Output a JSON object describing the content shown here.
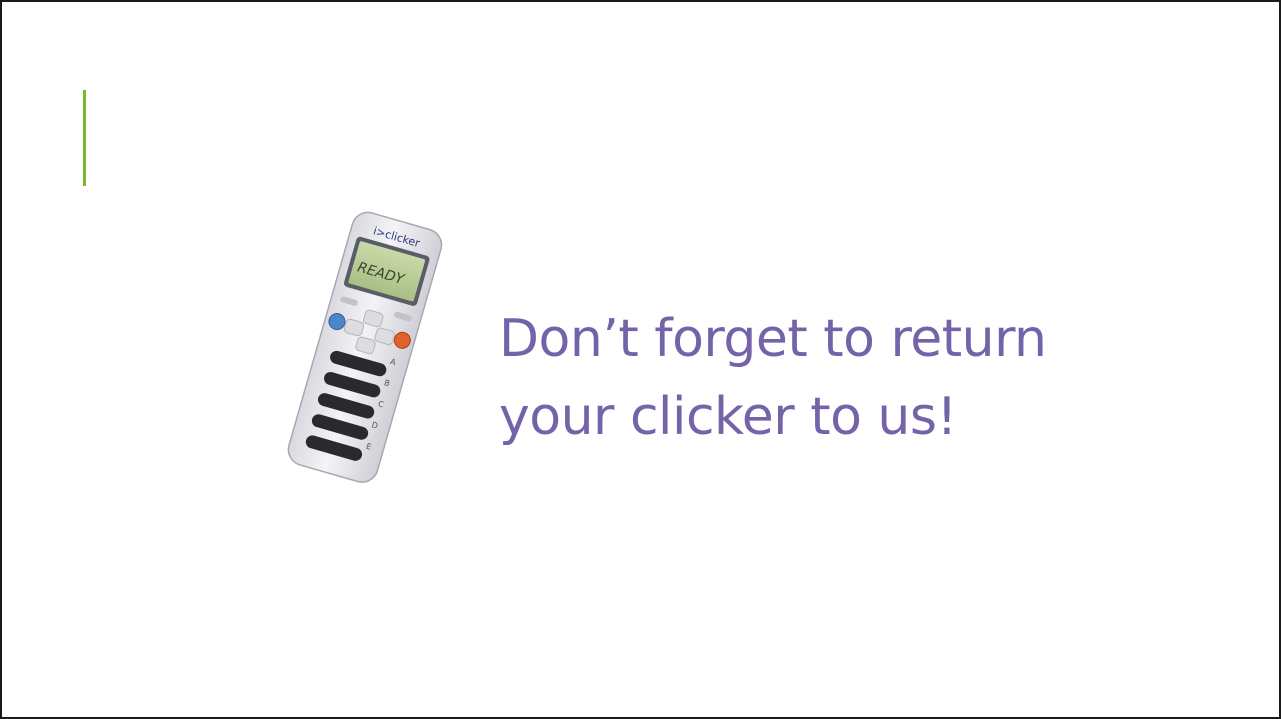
{
  "slide": {
    "accent_color": "#7cb82f",
    "text_color": "#7463a8",
    "message_lines": [
      "Don’t forget to return",
      "your clicker to us!"
    ]
  },
  "clicker": {
    "brand": "i>clicker",
    "display_text": "READY",
    "button_labels": [
      "A",
      "B",
      "C",
      "D",
      "E"
    ],
    "icon_name": "clicker-remote-icon"
  }
}
